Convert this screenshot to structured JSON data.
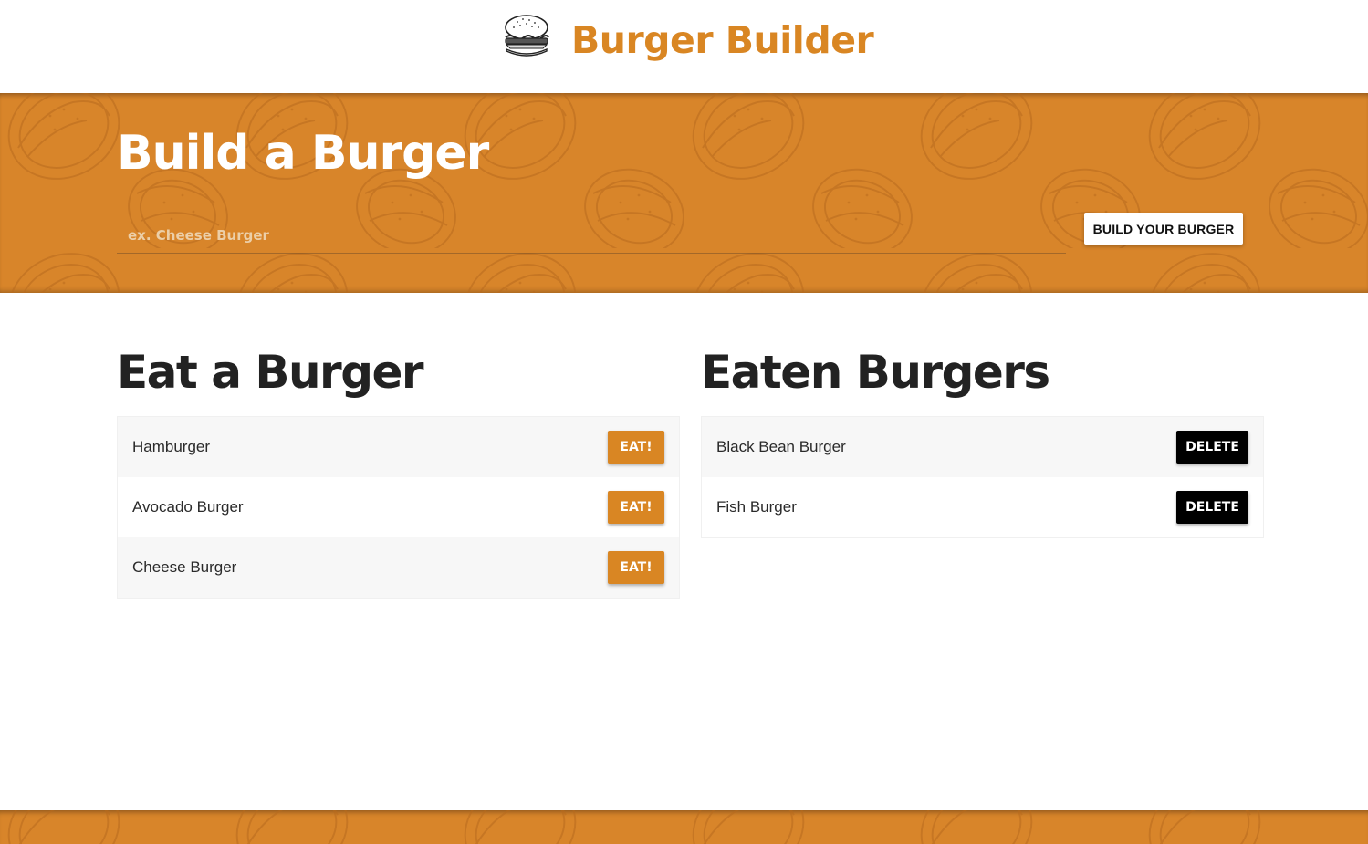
{
  "header": {
    "logo_icon": "burger-icon",
    "title": "Burger Builder"
  },
  "hero": {
    "title": "Build a Burger",
    "input": {
      "placeholder": "ex. Cheese Burger",
      "value": ""
    },
    "button_label": "BUILD YOUR BURGER"
  },
  "eat_section": {
    "heading": "Eat a Burger",
    "button_label": "EAT!",
    "items": [
      {
        "name": "Hamburger"
      },
      {
        "name": "Avocado Burger"
      },
      {
        "name": "Cheese Burger"
      }
    ]
  },
  "eaten_section": {
    "heading": "Eaten Burgers",
    "button_label": "DELETE",
    "items": [
      {
        "name": "Black Bean Burger"
      },
      {
        "name": "Fish Burger"
      }
    ]
  },
  "colors": {
    "brand_orange": "#d98623",
    "banner_orange": "#d8852a",
    "delete_black": "#000000",
    "row_alt": "#f7f7f7"
  }
}
